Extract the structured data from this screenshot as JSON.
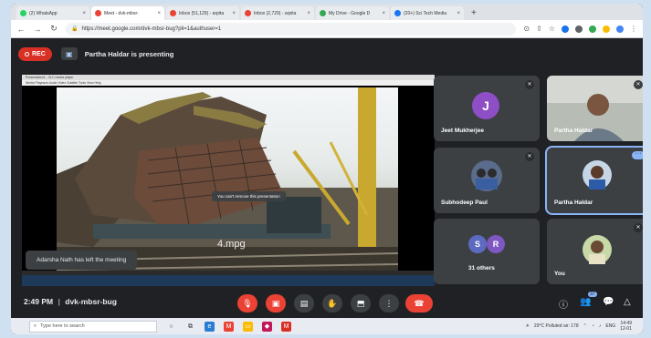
{
  "browser": {
    "tabs": [
      {
        "label": "(2) WhatsApp",
        "color": "#25d366",
        "active": false
      },
      {
        "label": "Meet - dvk-mbsr-",
        "color": "#ea4335",
        "active": true
      },
      {
        "label": "Inbox (51,129) - arpita",
        "color": "#ea4335",
        "active": false
      },
      {
        "label": "Inbox (2,729) - arpita",
        "color": "#ea4335",
        "active": false
      },
      {
        "label": "My Drive - Google D",
        "color": "#34a853",
        "active": false
      },
      {
        "label": "(20+) Sci Tech Media",
        "color": "#1877f2",
        "active": false
      }
    ],
    "new_tab": "+",
    "url": "https://meet.google.com/dvk-mbsr-bug?pli=1&authuser=1"
  },
  "meet": {
    "rec_label": "REC",
    "presenting_label": "Partha Haldar is presenting",
    "presentation": {
      "window_title": "Presentation1 - VLC media player",
      "menu": "Media  Playback  Audio  Video  Subtitle  Tools  View  Help",
      "video_label": "4.mpg",
      "tooltip": "You can't remove this presentation"
    },
    "toast": "Adarsha Nath has left the meeting",
    "tiles": [
      {
        "name": "Jeet Mukherjee",
        "initial": "J",
        "avatar_color": "#8e4ec6"
      },
      {
        "name": "Partha Haldar",
        "initial": "",
        "avatar_color": ""
      },
      {
        "name": "Subhodeep Paul",
        "initial": "",
        "avatar_color": ""
      },
      {
        "name": "Partha Haldar",
        "initial": "",
        "avatar_color": ""
      },
      {
        "name": "31 others",
        "initials": [
          "S",
          "R"
        ],
        "avatar_color": "#5c6bc0"
      },
      {
        "name": "You",
        "initial": "",
        "avatar_color": ""
      }
    ],
    "bottom": {
      "time": "2:49 PM",
      "separator": "|",
      "code": "dvk-mbsr-bug",
      "people_badge": "37"
    }
  },
  "windows": {
    "search_placeholder": "Type here to search",
    "weather": "29°C  Polluted air: 178",
    "lang": "ENG",
    "time": "14:49",
    "date": "12-01"
  },
  "icons": {
    "mic": "mic-off-icon",
    "cam": "camera-off-icon",
    "captions": "captions-icon",
    "hand": "raise-hand-icon",
    "present": "present-icon",
    "more": "more-options-icon",
    "leave": "leave-call-icon"
  },
  "colors": {
    "meet_bg": "#202124",
    "tile_bg": "#3c4043",
    "danger": "#ea4335",
    "accent": "#8ab4f8"
  }
}
